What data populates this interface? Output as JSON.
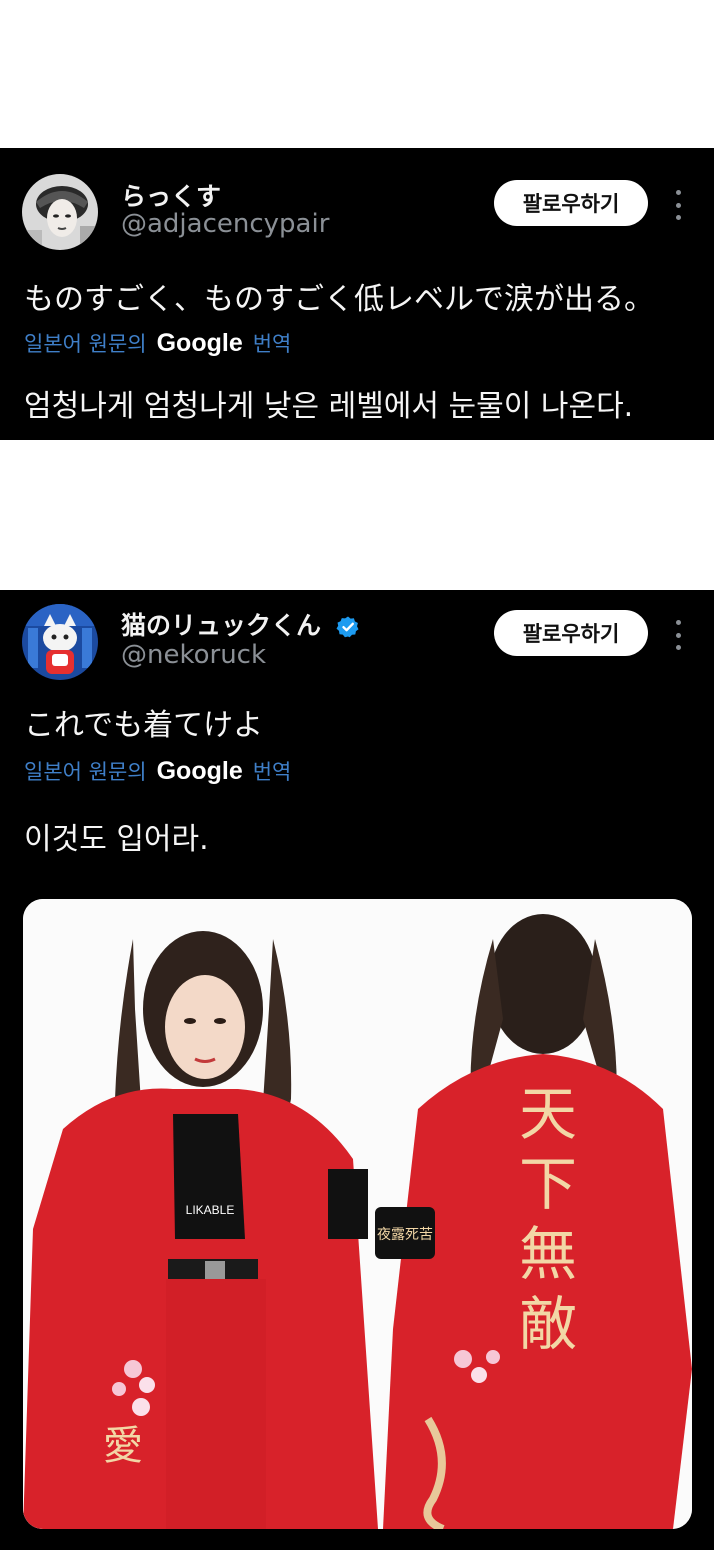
{
  "tweets": [
    {
      "display_name": "らっくす",
      "handle": "@adjacencypair",
      "follow_label": "팔로우하기",
      "text": "ものすごく、ものすごく低レベルで涙が出る。",
      "translate_prefix": "일본어 원문의",
      "translate_brand": "Google",
      "translate_suffix": "번역",
      "translation": "엄청나게 엄청나게 낮은 레벨에서 눈물이 나온다.",
      "verified": false
    },
    {
      "display_name": "猫のリュックくん",
      "handle": "@nekoruck",
      "follow_label": "팔로우하기",
      "text": "これでも着てけよ",
      "translate_prefix": "일본어 원문의",
      "translate_brand": "Google",
      "translate_suffix": "번역",
      "translation": "이것도 입어라.",
      "verified": true,
      "media": {
        "shirt_label": "LIKABLE",
        "back_text": [
          "天",
          "下",
          "無",
          "敵"
        ],
        "armband_text": "夜露死苦"
      }
    }
  ],
  "colors": {
    "card_bg": "#000000",
    "translate_link": "#3f7fc8",
    "handle": "#8b9096",
    "verified": "#1d9bf0",
    "jacket_red": "#d8222a"
  }
}
